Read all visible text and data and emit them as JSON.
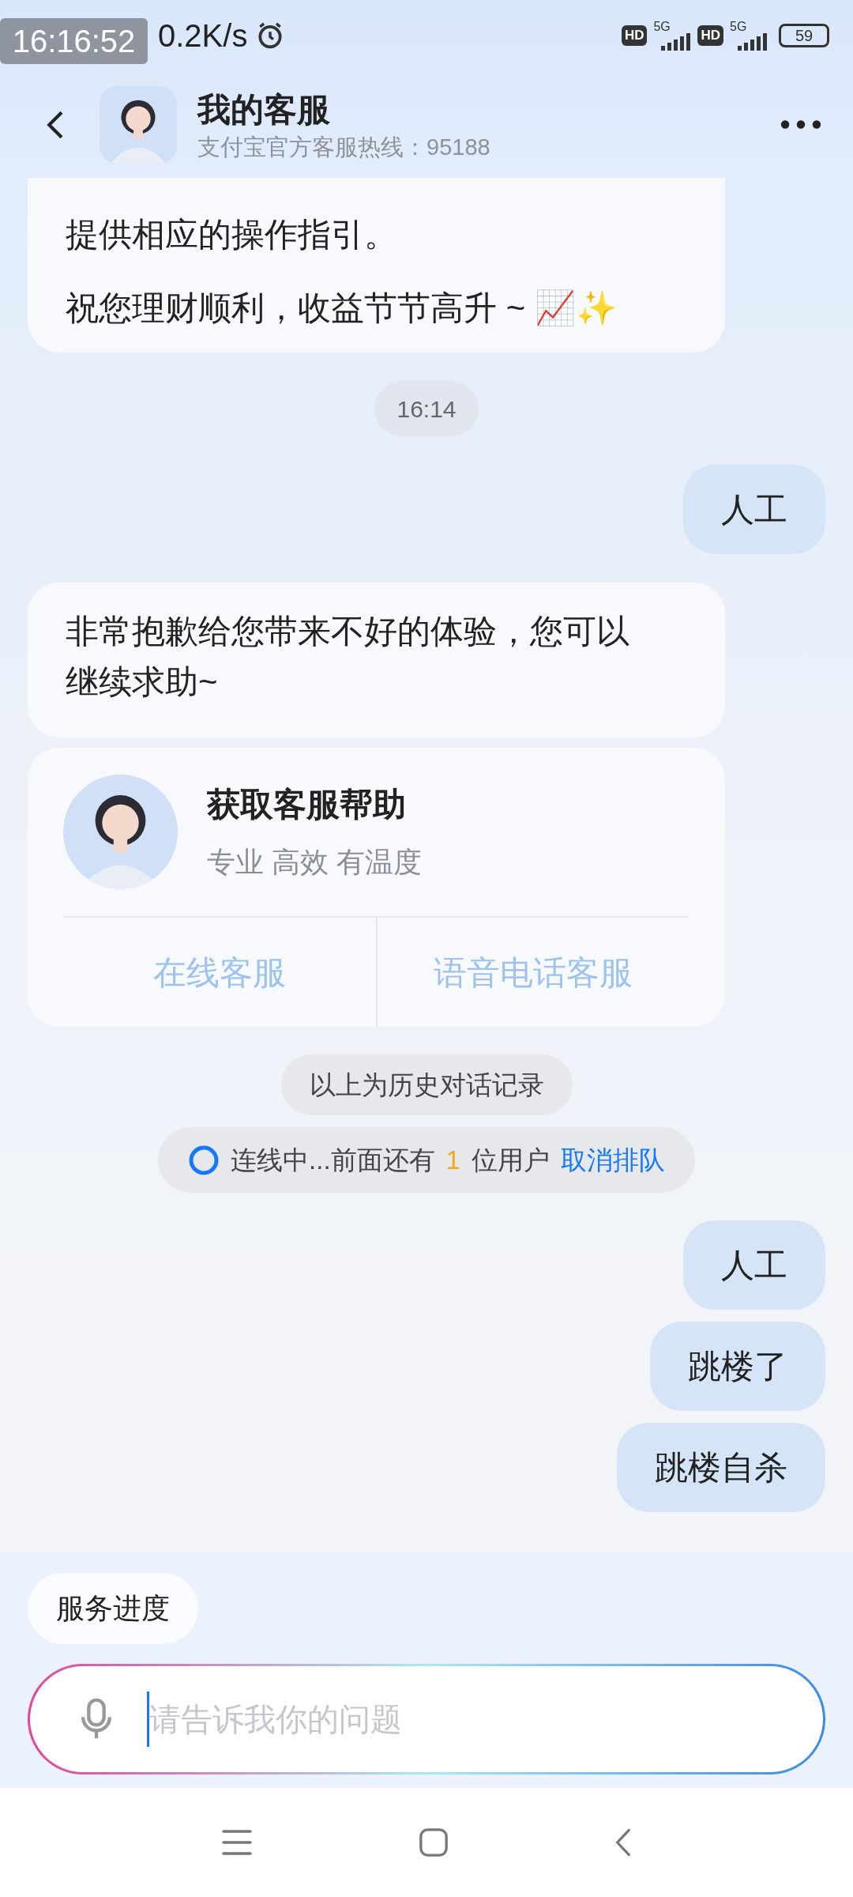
{
  "status_bar": {
    "recording_time": "16:16:52",
    "net_speed": "0.2K/s",
    "sims": [
      {
        "badge": "HD",
        "network": "5G"
      },
      {
        "badge": "HD",
        "network": "5G"
      }
    ],
    "battery": "59"
  },
  "header": {
    "title": "我的客服",
    "subtitle": "支付宝官方客服热线：95188"
  },
  "messages": [
    {
      "kind": "bot",
      "paragraphs": [
        "提供相应的操作指引。",
        "祝您理财顺利，收益节节高升 ~ 📈✨"
      ]
    },
    {
      "kind": "time",
      "text": "16:14"
    },
    {
      "kind": "user",
      "text": "人工"
    },
    {
      "kind": "bot",
      "paragraphs": [
        "非常抱歉给您带来不好的体验，您可以继续求助~"
      ]
    },
    {
      "kind": "card",
      "title": "获取客服帮助",
      "subtitle": "专业 高效 有温度",
      "actions": [
        "在线客服",
        "语音电话客服"
      ]
    },
    {
      "kind": "notice",
      "text": "以上为历史对话记录"
    },
    {
      "kind": "queue",
      "status": "连线中...前面还有",
      "count": "1",
      "unit": "位用户",
      "action": "取消排队"
    },
    {
      "kind": "user",
      "text": "人工"
    },
    {
      "kind": "user",
      "text": "跳楼了"
    },
    {
      "kind": "user",
      "text": "跳楼自杀"
    }
  ],
  "quick_actions": [
    "服务进度"
  ],
  "input": {
    "placeholder": "请告诉我你的问题"
  }
}
